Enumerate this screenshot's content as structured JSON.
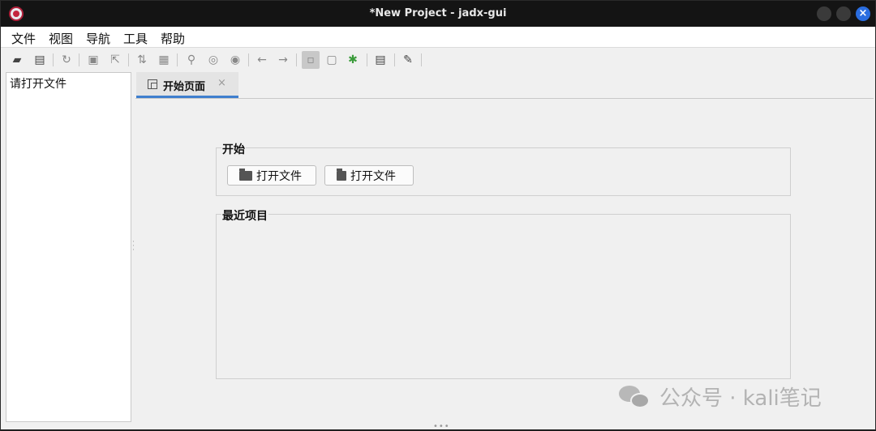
{
  "window": {
    "title": "*New Project - jadx-gui",
    "close_symbol": "×"
  },
  "menubar": {
    "items": [
      "文件",
      "视图",
      "导航",
      "工具",
      "帮助"
    ]
  },
  "toolbar": {
    "icons": [
      "open-folder-icon",
      "add-files-icon",
      "reload-icon",
      "save-icon",
      "export-icon",
      "sync-tree-icon",
      "flatten-packages-icon",
      "search-icon",
      "find-class-icon",
      "find-usage-icon",
      "back-arrow-icon",
      "forward-arrow-icon",
      "decompile-all-icon",
      "deobfuscation-icon",
      "debug-bug-icon",
      "log-viewer-icon",
      "preferences-wrench-icon"
    ]
  },
  "tree_panel": {
    "placeholder": "请打开文件"
  },
  "tabs": [
    {
      "label": "开始页面",
      "close": "×"
    }
  ],
  "start_page": {
    "start_group_title": "开始",
    "open_file_label": "打开文件",
    "open_project_label": "打开文件",
    "recent_group_title": "最近项目"
  },
  "watermark": {
    "text": "公众号 · kali笔记"
  },
  "colors": {
    "tab_accent": "#3f7fce",
    "titlebar": "#141414",
    "close_button": "#2a6de0",
    "debug_icon": "#3a9b3a"
  }
}
